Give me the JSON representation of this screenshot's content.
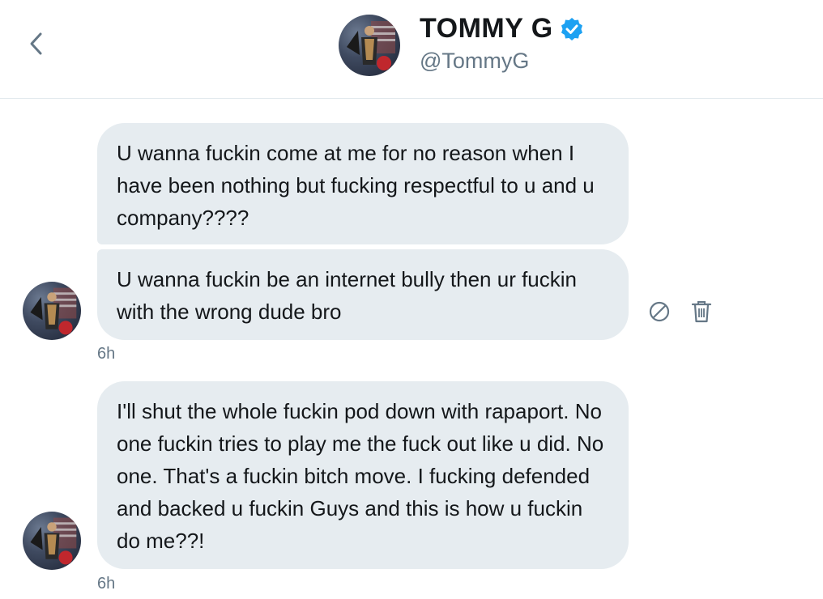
{
  "header": {
    "display_name": "TOMMY G",
    "handle": "@TommyG"
  },
  "messages": [
    {
      "text": "U wanna fuckin come at me for no reason when I have been nothing but fucking respectful to u and u company????"
    },
    {
      "text": "U wanna fuckin be an internet bully then ur fuckin with the wrong dude bro",
      "time": "6h"
    },
    {
      "text": "I'll shut the whole fuckin pod down with rapaport. No one fuckin tries to play me the fuck out like u did. No one. That's a fuckin bitch move. I fucking defended and backed u fuckin Guys and this is how u fuckin do me??!",
      "time": "6h"
    }
  ],
  "icons": {
    "back": "chevron-left-icon",
    "verified": "verified-badge-icon",
    "report": "block-icon",
    "delete": "trash-icon"
  },
  "colors": {
    "bubble": "#e6ecf0",
    "verified": "#1da1f2",
    "secondary_text": "#657786",
    "icon": "#657786"
  }
}
